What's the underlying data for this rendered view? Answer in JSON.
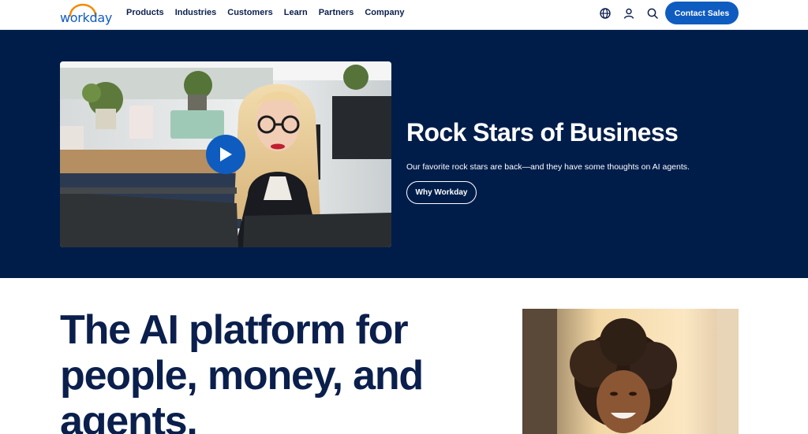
{
  "brand": {
    "logo_text": "workday",
    "color": "#0f5cc0",
    "arc_color": "#f38b00"
  },
  "nav": {
    "items": [
      {
        "label": "Products"
      },
      {
        "label": "Industries"
      },
      {
        "label": "Customers"
      },
      {
        "label": "Learn"
      },
      {
        "label": "Partners"
      },
      {
        "label": "Company"
      }
    ]
  },
  "header_icons": [
    "globe-icon",
    "user-icon",
    "search-icon"
  ],
  "header": {
    "contact_label": "Contact Sales"
  },
  "hero": {
    "background": "#001d4a",
    "title": "Rock Stars of Business",
    "subtitle": "Our favorite rock stars are back—and they have some thoughts on AI agents.",
    "cta_label": "Why Workday",
    "video_icon": "play-icon"
  },
  "main": {
    "headline": "The AI platform for people, money, and agents."
  }
}
